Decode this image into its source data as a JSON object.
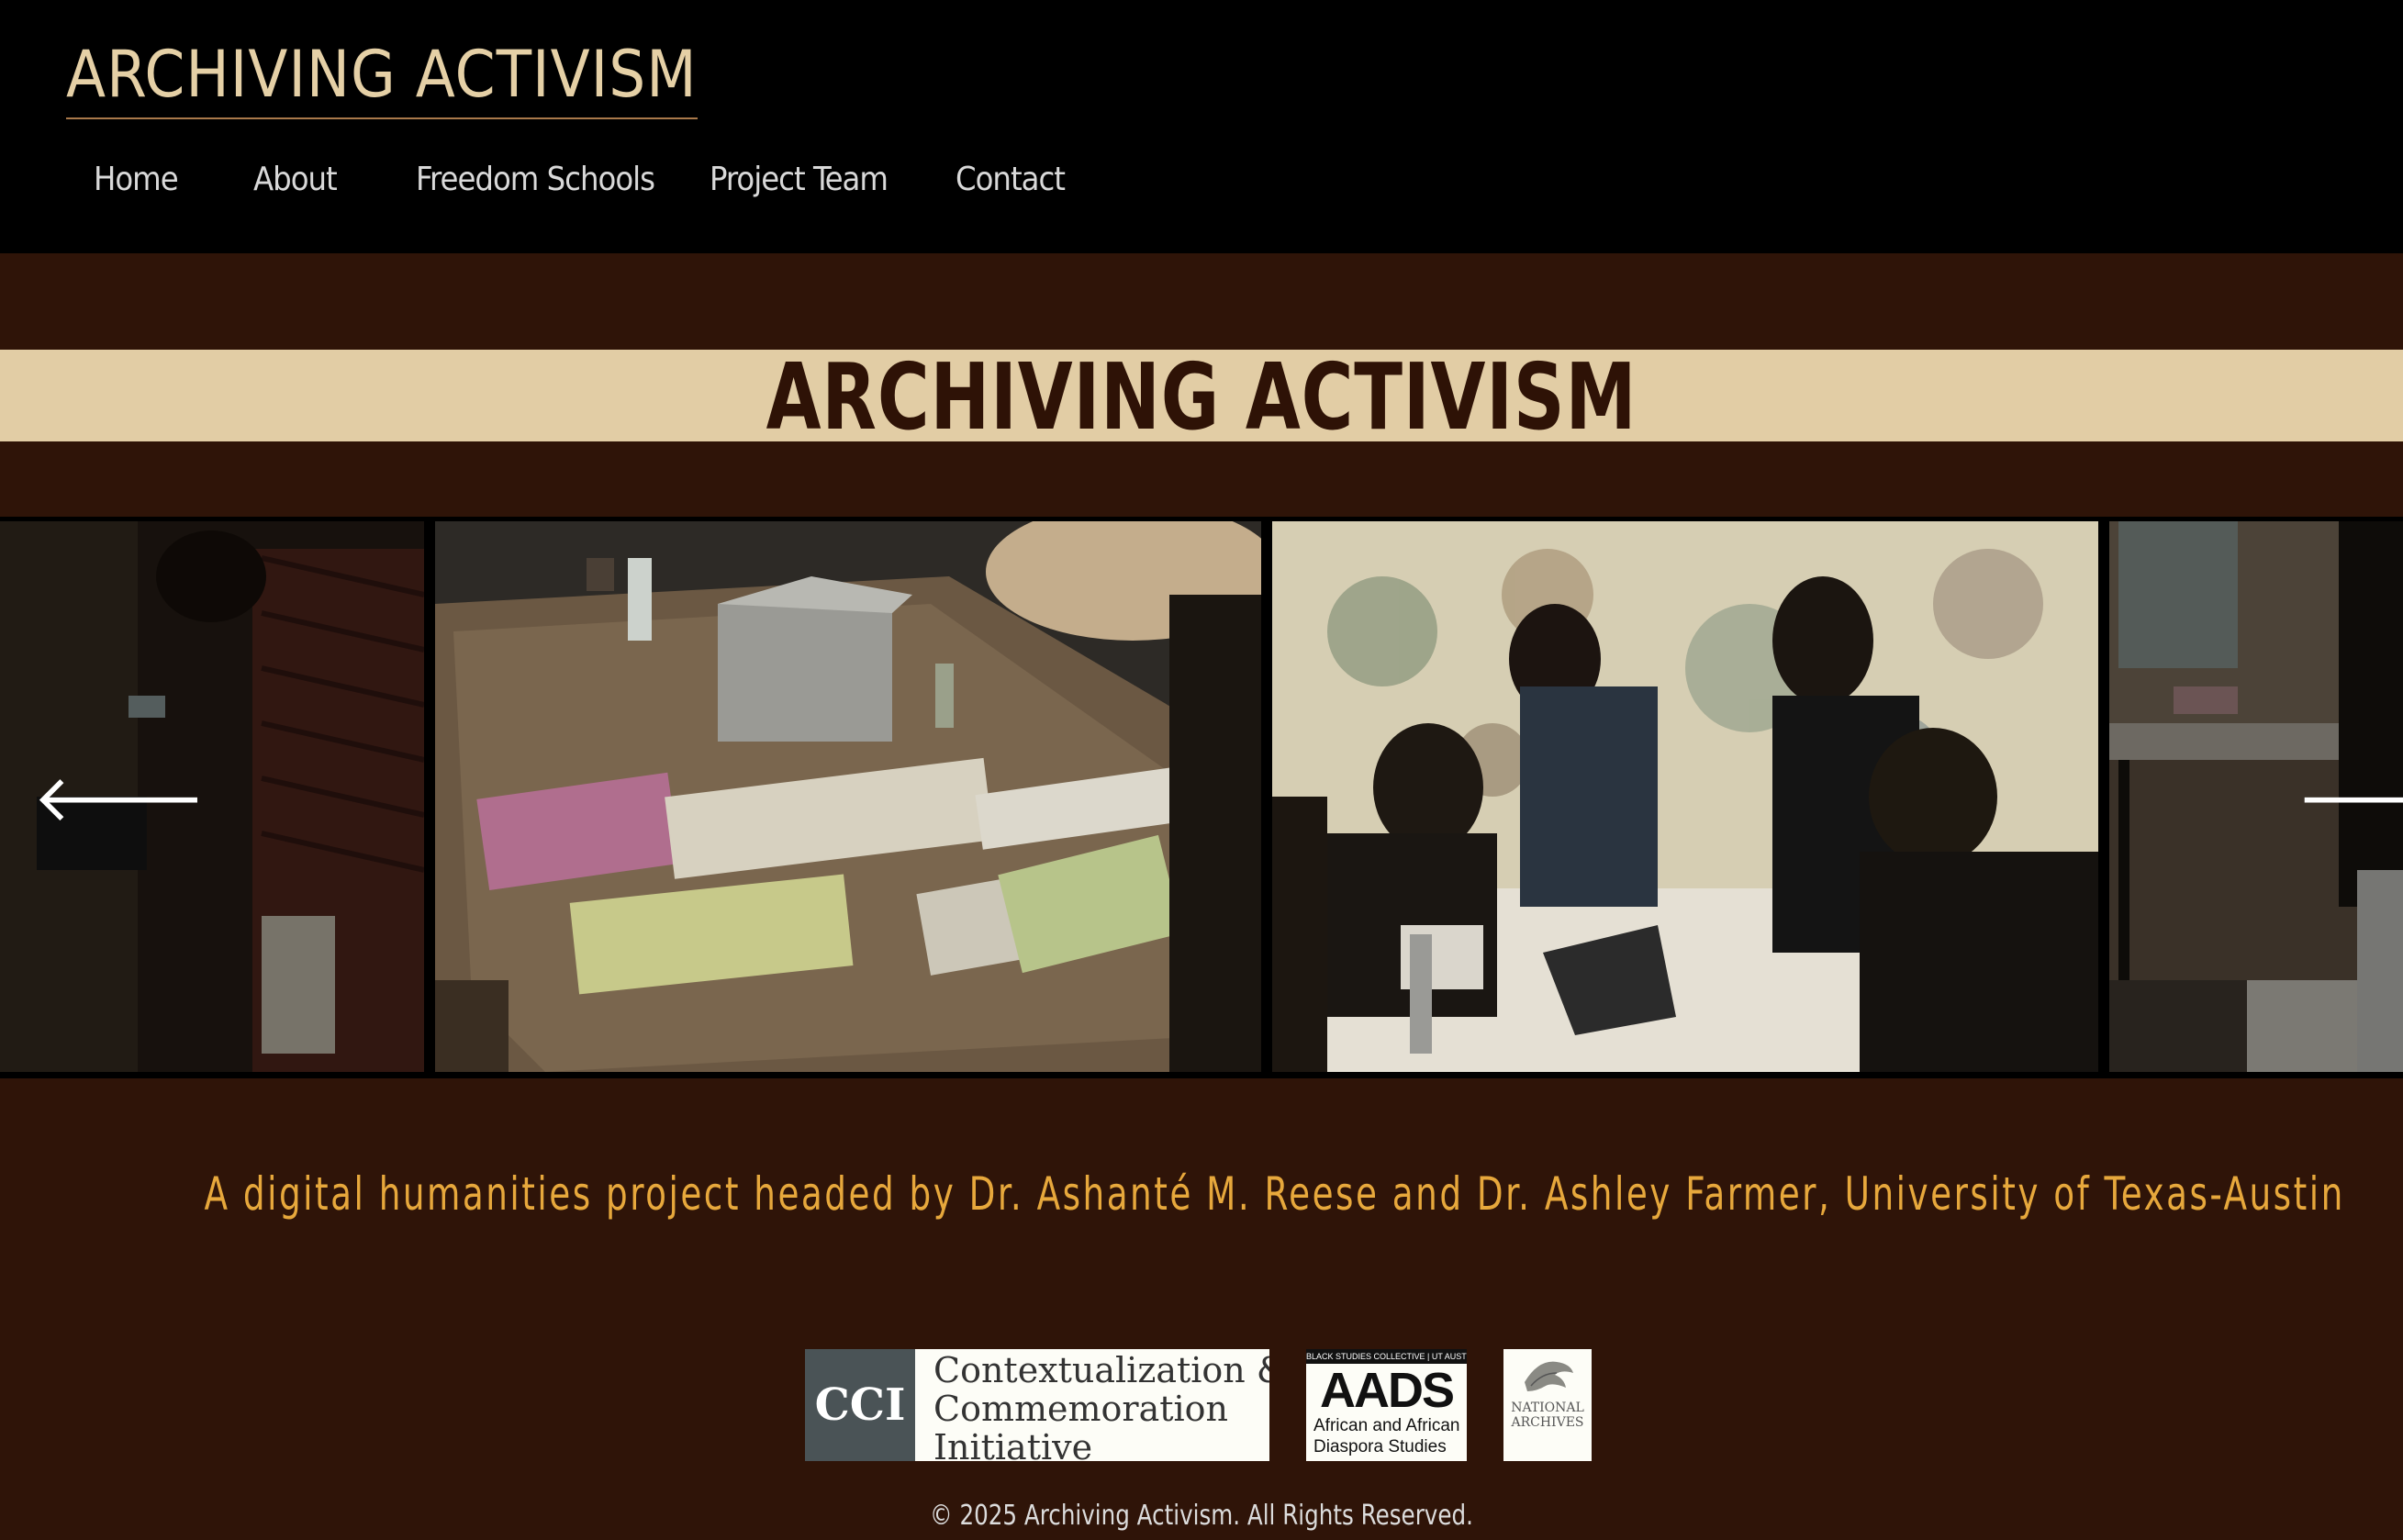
{
  "site": {
    "title": "ARCHIVING ACTIVISM"
  },
  "nav": {
    "items": [
      {
        "label": "Home"
      },
      {
        "label": "About"
      },
      {
        "label": "Freedom Schools"
      },
      {
        "label": "Project Team"
      },
      {
        "label": "Contact"
      }
    ]
  },
  "hero": {
    "title": "ARCHIVING ACTIVISM"
  },
  "carousel": {
    "prev_icon": "arrow-left-icon",
    "next_icon": "arrow-right-icon",
    "prev_glyph": "🡐",
    "next_glyph": "🡒"
  },
  "tagline": "A digital humanities project headed by Dr. Ashanté M. Reese and Dr. Ashley Farmer, University of Texas-Austin",
  "partners": {
    "cci": {
      "mark": "CCI",
      "line1": "Contextualization &",
      "line2": "Commemoration",
      "line3": "Initiative"
    },
    "aads": {
      "top": "BLACK STUDIES COLLECTIVE | UT AUSTIN",
      "mark": "AADS",
      "line1": "African and African",
      "line2": "Diaspora Studies"
    },
    "nara": {
      "line1": "NATIONAL",
      "line2": "ARCHIVES"
    }
  },
  "footer": {
    "copyright": "© 2025 Archiving Activism. All Rights Reserved."
  },
  "colors": {
    "header_bg": "#000000",
    "page_bg": "#2f1408",
    "banner_bg": "#e2cda5",
    "title_text": "#e5d0a6",
    "tagline": "#e7a83c"
  }
}
